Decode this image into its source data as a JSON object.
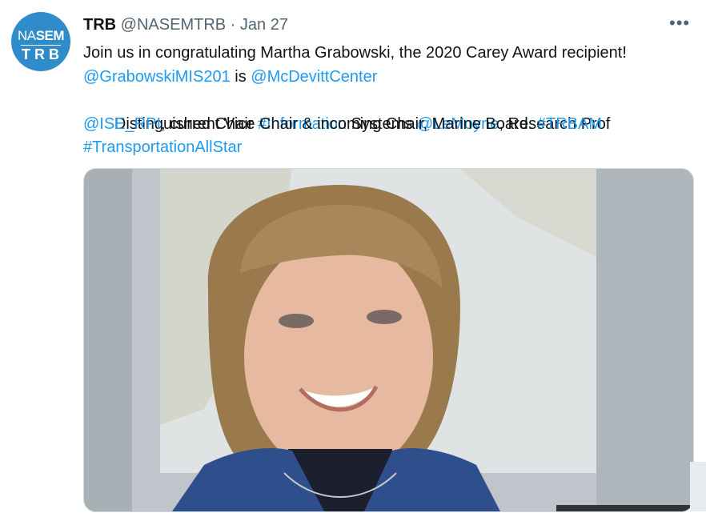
{
  "tweet": {
    "avatar": {
      "logo_top_a": "NA",
      "logo_top_b": "SEM",
      "logo_bottom": "TRB"
    },
    "display_name": "TRB",
    "handle": "@NASEMTRB",
    "separator": "·",
    "date": "Jan 27",
    "more_label": "•••",
    "text": {
      "line1": "Join us in congratulating Martha Grabowski, the 2020 Carey Award recipient!",
      "mention1": "@GrabowskiMIS201",
      "is_text": " is ",
      "mention2": "@McDevittCenter",
      "line3_a": " Distinguished Chair ",
      "hashtag1": "#Information",
      "line3_b": " Systems ",
      "mention3": "@LeMoyne",
      "line3_c": ", Research Prof",
      "mention4": "@ISE_RPI",
      "line4_b": ", current Vice Chair & incoming Chair, Marine Board. ",
      "hashtag2": "#TRBAM",
      "hashtag3": "#TransportationAllStar"
    },
    "media_alt": "video frame"
  },
  "colors": {
    "link": "#1d9bf0",
    "muted": "#536471",
    "avatar_bg": "#2f8bc9"
  }
}
